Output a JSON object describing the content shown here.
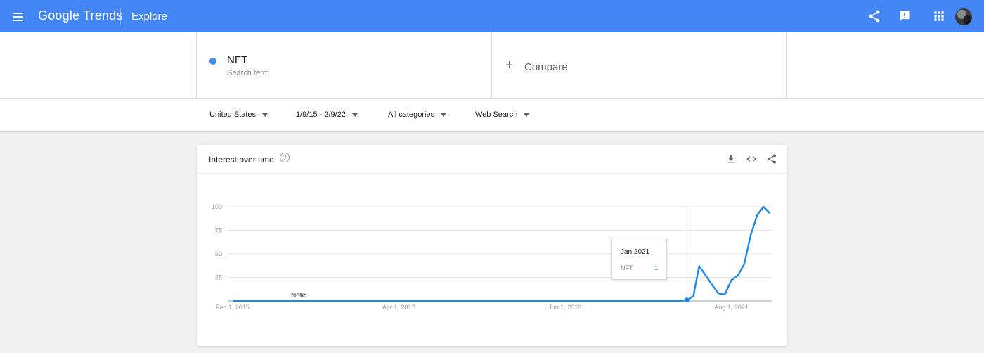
{
  "app": {
    "brand": "Google Trends",
    "section": "Explore",
    "icons": [
      "menu-icon",
      "share-icon",
      "feedback-icon",
      "apps-grid-icon",
      "account-avatar"
    ]
  },
  "search": {
    "term": "NFT",
    "term_sub": "Search term",
    "term_color": "#4285f4",
    "compare_label": "Compare"
  },
  "filters": {
    "region": "United States",
    "date_range": "1/9/15 - 2/9/22",
    "category": "All categories",
    "property": "Web Search"
  },
  "card": {
    "title": "Interest over time",
    "icons": [
      "help-icon",
      "download-icon",
      "embed-icon",
      "share-icon"
    ]
  },
  "tooltip": {
    "date": "Jan 2021",
    "term": "NFT",
    "value": "1"
  },
  "colors": {
    "appbar": "#4285f4",
    "series": "#1e88e5"
  },
  "chart_data": {
    "type": "line",
    "title": "Interest over time",
    "ylim": [
      0,
      100
    ],
    "y_ticks": [
      "100",
      "75",
      "50",
      "25"
    ],
    "x_ticks": [
      "Feb 1, 2015",
      "Apr 1, 2017",
      "Jun 1, 2019",
      "Aug 1, 2021"
    ],
    "grid": true,
    "annotation": "Note",
    "series": [
      {
        "name": "NFT",
        "points": [
          [
            "2015-02-01",
            0
          ],
          [
            "2016-01-01",
            0
          ],
          [
            "2017-01-01",
            0
          ],
          [
            "2018-01-01",
            0
          ],
          [
            "2019-01-01",
            0
          ],
          [
            "2020-01-01",
            0
          ],
          [
            "2020-12-01",
            0
          ],
          [
            "2021-01-01",
            1
          ],
          [
            "2021-02-01",
            5
          ],
          [
            "2021-03-01",
            37
          ],
          [
            "2021-04-01",
            27
          ],
          [
            "2021-05-01",
            17
          ],
          [
            "2021-06-01",
            8
          ],
          [
            "2021-07-01",
            7
          ],
          [
            "2021-08-01",
            22
          ],
          [
            "2021-09-01",
            27
          ],
          [
            "2021-10-01",
            39
          ],
          [
            "2021-11-01",
            70
          ],
          [
            "2021-12-01",
            91
          ],
          [
            "2022-01-01",
            100
          ],
          [
            "2022-02-01",
            93
          ]
        ]
      }
    ],
    "highlight": {
      "x": "2021-01-01",
      "y": 1
    }
  }
}
